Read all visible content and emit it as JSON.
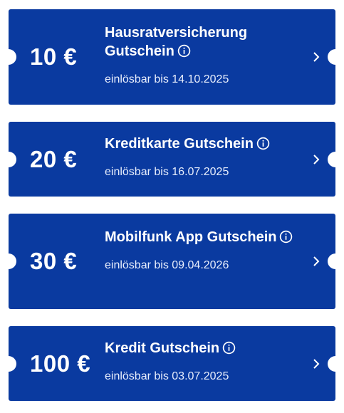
{
  "vouchers": [
    {
      "amount": "10 €",
      "title": "Hausratversicherung Gutschein",
      "expiry": "einlösbar bis 14.10.2025"
    },
    {
      "amount": "20 €",
      "title": "Kreditkarte Gutschein",
      "expiry": "einlösbar bis 16.07.2025"
    },
    {
      "amount": "30 €",
      "title": "Mobilfunk App Gutschein",
      "expiry": "einlösbar bis 09.04.2026"
    },
    {
      "amount": "100 €",
      "title": "Kredit Gutschein",
      "expiry": "einlösbar bis 03.07.2025"
    }
  ],
  "colors": {
    "card_background": "#0a3aa0",
    "text": "#ffffff",
    "page_background": "#ffffff"
  },
  "icons": {
    "info": "info-circle-icon",
    "chevron": "chevron-right-icon"
  }
}
